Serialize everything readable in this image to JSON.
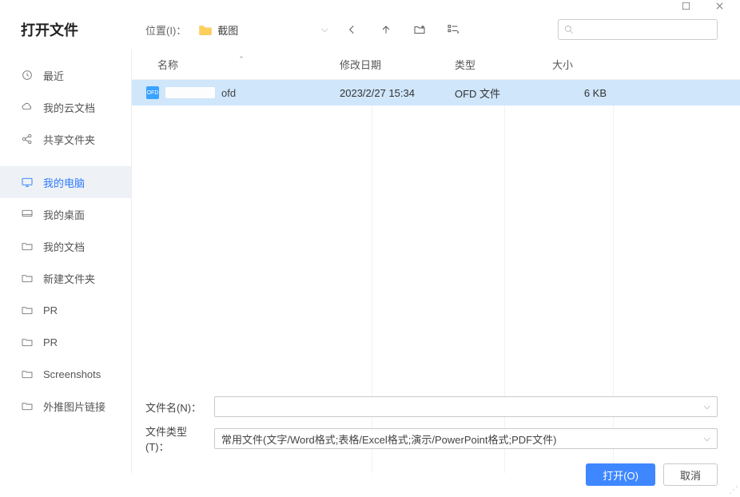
{
  "window": {
    "title": "打开文件",
    "location_label": "位置(I)：",
    "current_folder": "截图",
    "search_placeholder": ""
  },
  "sidebar": {
    "items": [
      {
        "icon": "clock-icon",
        "label": "最近",
        "active": false
      },
      {
        "icon": "cloud-icon",
        "label": "我的云文档",
        "active": false
      },
      {
        "icon": "share-icon",
        "label": "共享文件夹",
        "active": false
      },
      {
        "icon": "monitor-icon",
        "label": "我的电脑",
        "active": true
      },
      {
        "icon": "desktop-icon",
        "label": "我的桌面",
        "active": false
      },
      {
        "icon": "folder-icon",
        "label": "我的文档",
        "active": false
      },
      {
        "icon": "folder-icon",
        "label": "新建文件夹",
        "active": false
      },
      {
        "icon": "folder-icon",
        "label": "PR",
        "active": false
      },
      {
        "icon": "folder-icon",
        "label": "PR",
        "active": false
      },
      {
        "icon": "folder-icon",
        "label": "Screenshots",
        "active": false
      },
      {
        "icon": "folder-icon",
        "label": "外推图片链接",
        "active": false
      }
    ]
  },
  "columns": {
    "name": "名称",
    "date": "修改日期",
    "type": "类型",
    "size": "大小"
  },
  "files": [
    {
      "name_ext": "ofd",
      "date": "2023/2/27 15:34",
      "type": "OFD 文件",
      "size": "6 KB",
      "selected": true
    }
  ],
  "footer": {
    "filename_label": "文件名(N)：",
    "filename_value": "",
    "filetype_label": "文件类型(T)：",
    "filetype_value": "常用文件(文字/Word格式;表格/Excel格式;演示/PowerPoint格式;PDF文件)",
    "open_label": "打开(O)",
    "cancel_label": "取消"
  }
}
